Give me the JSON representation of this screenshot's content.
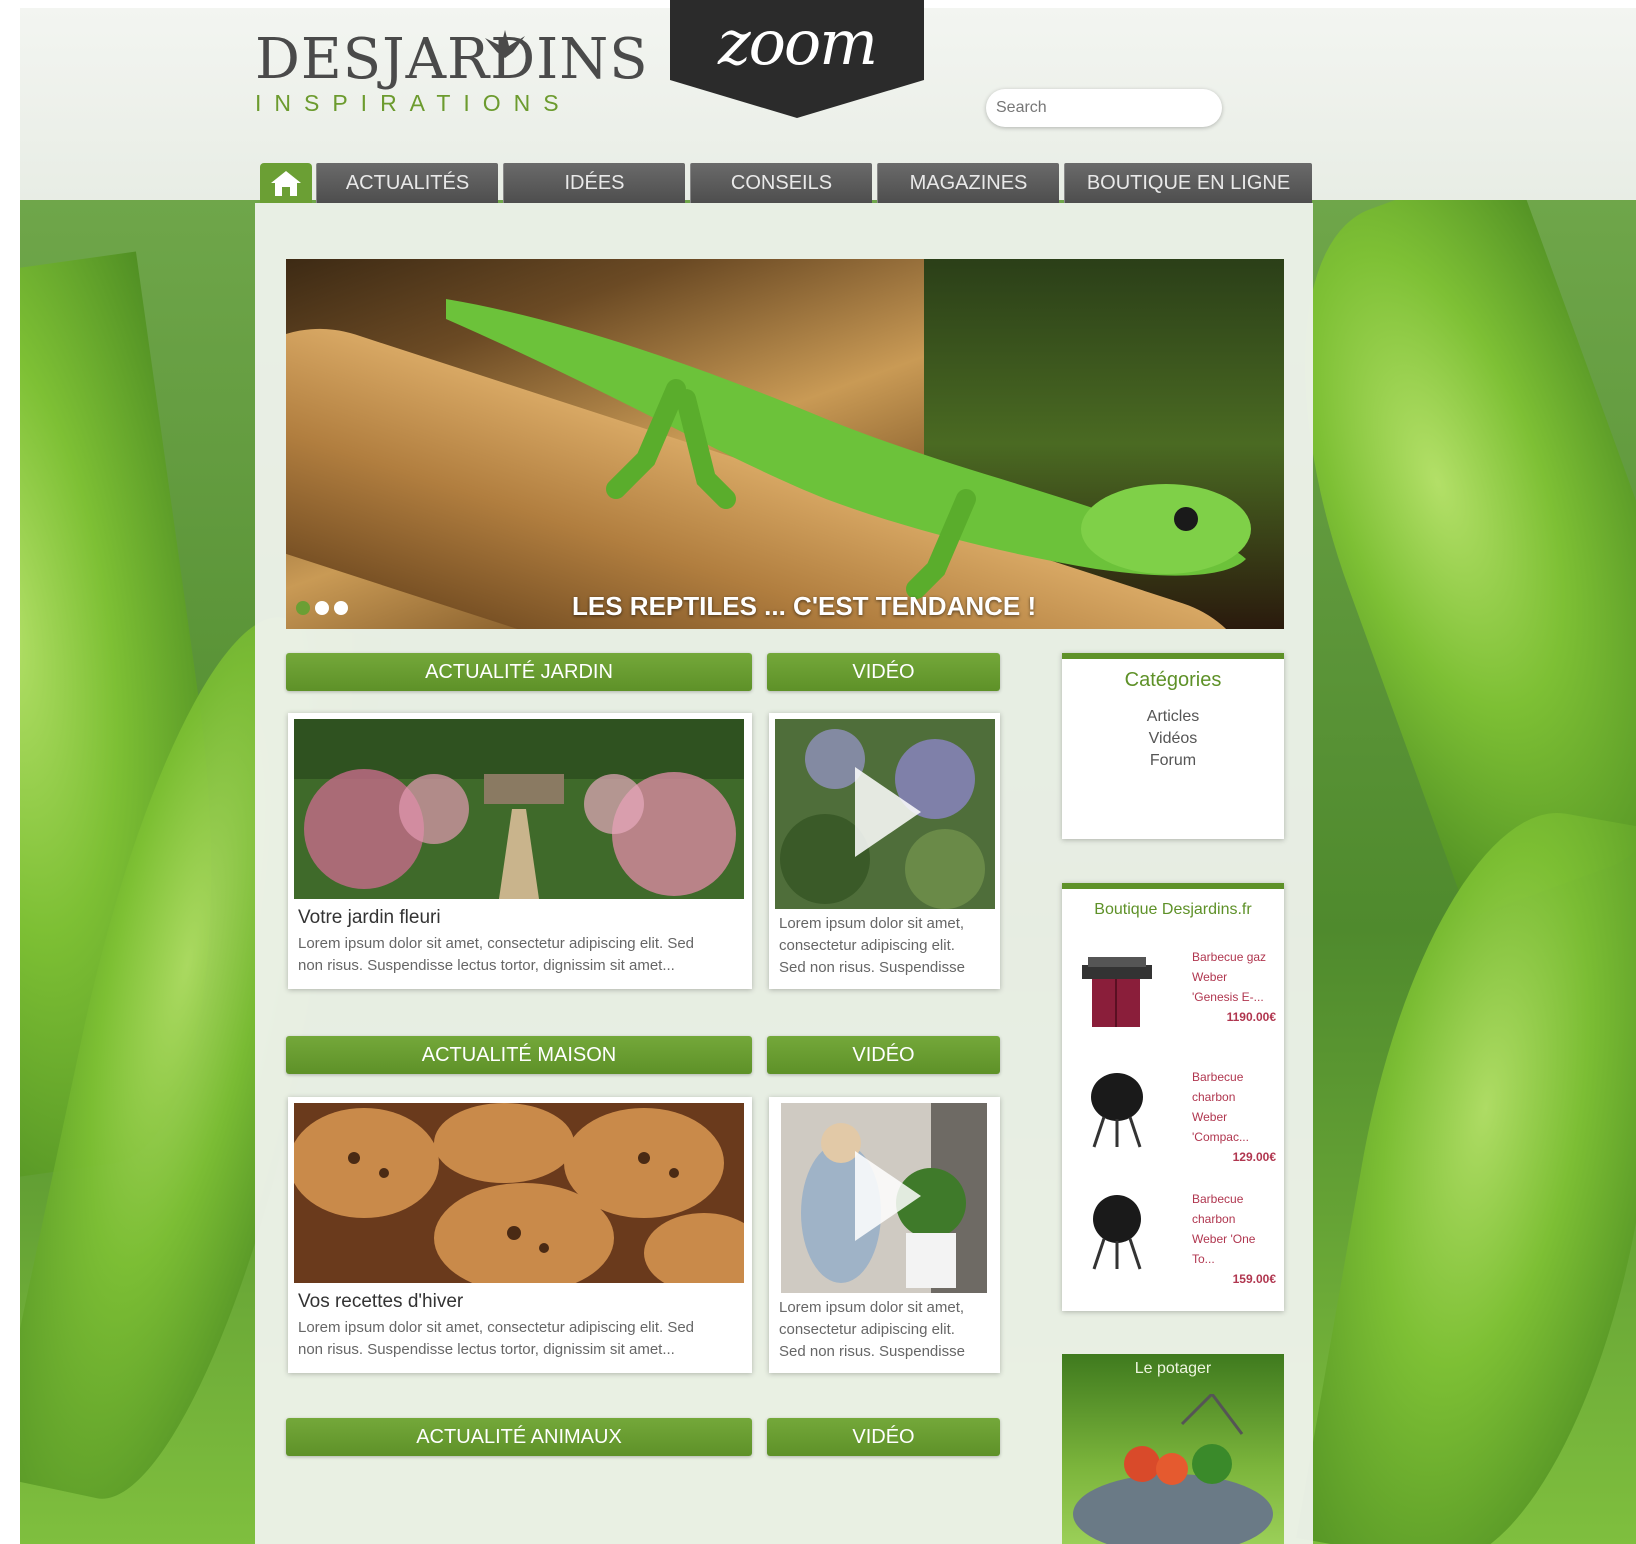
{
  "zoom_badge": "zoom",
  "logo": {
    "name": "DESJARDINS",
    "tagline": "INSPIRATIONS"
  },
  "search": {
    "placeholder": "Search"
  },
  "nav": {
    "tabs": [
      "ACTUALITÉS",
      "IDÉES",
      "CONSEILS",
      "MAGAZINES",
      "BOUTIQUE EN LIGNE"
    ]
  },
  "hero": {
    "caption": "LES REPTILES ... C'EST TENDANCE !"
  },
  "sections": [
    {
      "header": "ACTUALITÉ JARDIN",
      "video_header": "VIDÉO",
      "card_title": "Votre jardin fleuri",
      "card_text": [
        "Lorem ipsum dolor sit amet, consectetur adipiscing elit. Sed",
        "non risus. Suspendisse lectus tortor, dignissim sit amet..."
      ],
      "video_text": [
        "Lorem ipsum dolor sit amet,",
        "consectetur adipiscing elit.",
        "Sed non risus. Suspendisse"
      ]
    },
    {
      "header": "ACTUALITÉ MAISON",
      "video_header": "VIDÉO",
      "card_title": "Vos recettes d'hiver",
      "card_text": [
        "Lorem ipsum dolor sit amet, consectetur adipiscing elit. Sed",
        "non risus. Suspendisse lectus tortor, dignissim sit amet..."
      ],
      "video_text": [
        "Lorem ipsum dolor sit amet,",
        "consectetur adipiscing elit.",
        "Sed non risus. Suspendisse"
      ]
    },
    {
      "header": "ACTUALITÉ ANIMAUX",
      "video_header": "VIDÉO"
    }
  ],
  "categories": {
    "title": "Catégories",
    "items": [
      "Articles",
      "Vidéos",
      "Forum"
    ]
  },
  "shop": {
    "title": "Boutique Desjardins.fr",
    "products": [
      {
        "name": [
          "Barbecue gaz",
          "Weber",
          "'Genesis E-..."
        ],
        "price": "1190.00€"
      },
      {
        "name": [
          "Barbecue",
          "charbon",
          "Weber",
          "'Compac..."
        ],
        "price": "129.00€"
      },
      {
        "name": [
          "Barbecue",
          "charbon",
          "Weber 'One",
          "To..."
        ],
        "price": "159.00€"
      }
    ]
  },
  "promo": {
    "title": "Le potager"
  },
  "colors": {
    "accent": "#5e9128",
    "nav_tab": "#555555",
    "price": "#b0364f"
  }
}
